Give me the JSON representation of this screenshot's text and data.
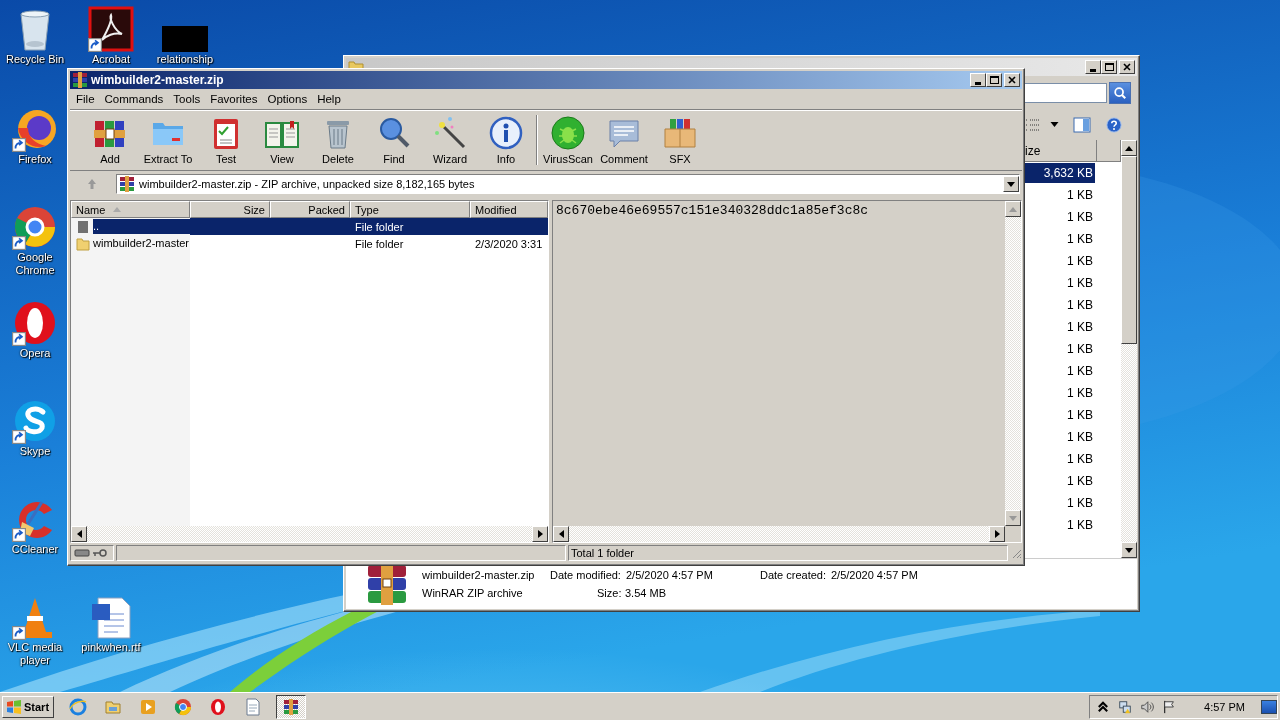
{
  "desktop_icons": [
    {
      "label": "Recycle Bin",
      "shortcut": false
    },
    {
      "label": "Acrobat",
      "shortcut": true
    },
    {
      "label": "relationship",
      "shortcut": false
    },
    {
      "label": "Firefox",
      "shortcut": true
    },
    {
      "label": "Google Chrome",
      "shortcut": true
    },
    {
      "label": "Opera",
      "shortcut": true
    },
    {
      "label": "Skype",
      "shortcut": true
    },
    {
      "label": "CCleaner",
      "shortcut": true
    },
    {
      "label": "VLC media player",
      "shortcut": true
    },
    {
      "label": "pinkwhen.rtf",
      "shortcut": false
    }
  ],
  "explorer_window": {
    "active": false,
    "size_header": "ize",
    "rows": [
      {
        "size": "3,632 KB",
        "selected": true
      },
      {
        "size": "1 KB",
        "selected": false
      },
      {
        "size": "1 KB",
        "selected": false
      },
      {
        "size": "1 KB",
        "selected": false
      },
      {
        "size": "1 KB",
        "selected": false
      },
      {
        "size": "1 KB",
        "selected": false
      },
      {
        "size": "1 KB",
        "selected": false
      },
      {
        "size": "1 KB",
        "selected": false
      },
      {
        "size": "1 KB",
        "selected": false
      },
      {
        "size": "1 KB",
        "selected": false
      },
      {
        "size": "1 KB",
        "selected": false
      },
      {
        "size": "1 KB",
        "selected": false
      },
      {
        "size": "1 KB",
        "selected": false
      },
      {
        "size": "1 KB",
        "selected": false
      },
      {
        "size": "1 KB",
        "selected": false
      },
      {
        "size": "1 KB",
        "selected": false
      },
      {
        "size": "1 KB",
        "selected": false
      }
    ],
    "details": {
      "name": "wimbuilder2-master.zip",
      "type": "WinRAR ZIP archive",
      "modified_label": "Date modified:",
      "modified": "2/5/2020 4:57 PM",
      "created_label": "Date created:",
      "created": "2/5/2020 4:57 PM",
      "size_label": "Size:",
      "size": "3.54 MB"
    }
  },
  "winrar_window": {
    "active": true,
    "title": "wimbuilder2-master.zip",
    "menu": [
      "File",
      "Commands",
      "Tools",
      "Favorites",
      "Options",
      "Help"
    ],
    "toolbar": [
      {
        "label": "Add"
      },
      {
        "label": "Extract To"
      },
      {
        "label": "Test"
      },
      {
        "label": "View"
      },
      {
        "label": "Delete"
      },
      {
        "label": "Find"
      },
      {
        "label": "Wizard"
      },
      {
        "label": "Info"
      },
      {
        "label": "VirusScan"
      },
      {
        "label": "Comment"
      },
      {
        "label": "SFX"
      }
    ],
    "address": "wimbuilder2-master.zip - ZIP archive, unpacked size 8,182,165 bytes",
    "columns": [
      "Name",
      "Size",
      "Packed",
      "Type",
      "Modified"
    ],
    "files": [
      {
        "kind": "parent",
        "name": "..",
        "type": "File folder",
        "selected": true
      },
      {
        "kind": "folder",
        "name": "wimbuilder2-master",
        "type": "File folder",
        "modified": "2/3/2020 3:31",
        "selected": false
      }
    ],
    "comment": "8c670ebe46e69557c151e340328ddc1a85ef3c8c",
    "status": "Total 1 folder"
  },
  "taskbar": {
    "start": "Start",
    "apps": [
      {
        "active": false
      },
      {
        "active": false
      },
      {
        "active": false
      },
      {
        "active": false
      },
      {
        "active": false
      },
      {
        "active": false
      },
      {
        "active": true
      }
    ],
    "clock": "4:57 PM"
  }
}
